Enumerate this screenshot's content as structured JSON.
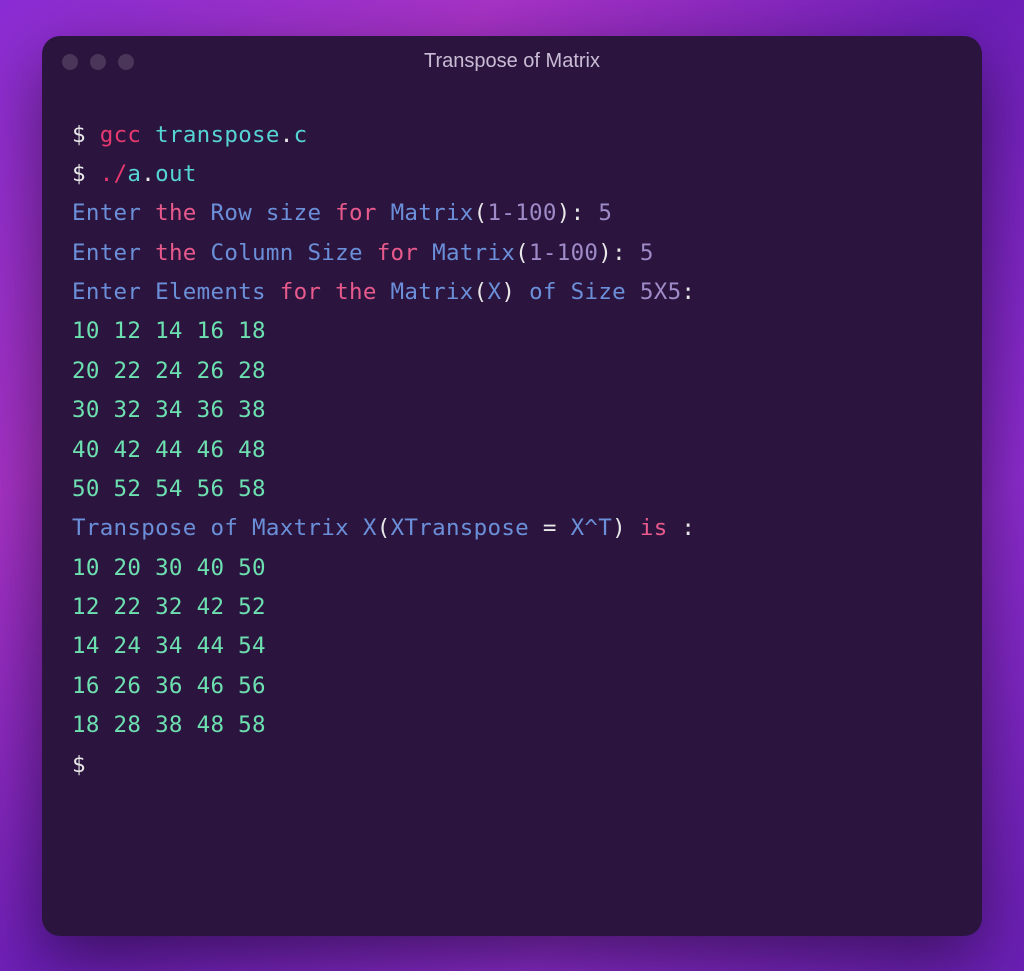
{
  "window": {
    "title": "Transpose of Matrix"
  },
  "terminal": {
    "prompt": "$",
    "cmd1": {
      "gcc": "gcc",
      "transpose": "transpose",
      "dot": ".",
      "c": "c"
    },
    "cmd2": {
      "dotslash": "./",
      "a": "a",
      "dot": ".",
      "out": "out"
    },
    "row_prompt": {
      "enter": "Enter",
      "the": "the",
      "row": "Row",
      "size": "size",
      "for": "for",
      "matrix": "Matrix",
      "paren_open": "(",
      "range": "1-100",
      "paren_close": ")",
      "colon": ":",
      "value": "5"
    },
    "col_prompt": {
      "enter": "Enter",
      "the": "the",
      "column": "Column",
      "size": "Size",
      "for": "for",
      "matrix": "Matrix",
      "paren_open": "(",
      "range": "1-100",
      "paren_close": ")",
      "colon": ":",
      "value": "5"
    },
    "elem_prompt": {
      "enter": "Enter",
      "elements": "Elements",
      "for": "for",
      "the": "the",
      "matrix": "Matrix",
      "paren_open": "(",
      "x": "X",
      "paren_close": ")",
      "of": "of",
      "size": "Size",
      "dims": "5X5",
      "colon": ":"
    },
    "matrix_rows": [
      "10 12 14 16 18",
      "20 22 24 26 28",
      "30 32 34 36 38",
      "40 42 44 46 48",
      "50 52 54 56 58"
    ],
    "transpose_label": {
      "transpose": "Transpose",
      "of": "of",
      "maxtrix": "Maxtrix",
      "x": "X",
      "paren_open": "(",
      "xtranspose": "XTranspose",
      "equals": " = ",
      "xcaret": "X^T",
      "paren_close": ")",
      "is": "is",
      "colon": ":"
    },
    "transpose_rows": [
      "10 20 30 40 50",
      "12 22 32 42 52",
      "14 24 34 44 54",
      "16 26 36 46 56",
      "18 28 38 48 58"
    ]
  }
}
